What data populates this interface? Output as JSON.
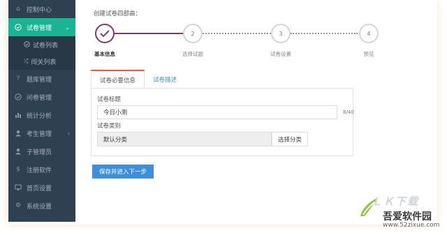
{
  "sidebar": {
    "items": [
      {
        "label": "控制中心",
        "icon": "home-icon"
      },
      {
        "label": "试卷管理",
        "icon": "check-circle-icon",
        "active": true
      },
      {
        "label": "题库管理",
        "icon": "question-icon"
      },
      {
        "label": "问卷管理",
        "icon": "check-circle-icon"
      },
      {
        "label": "统计分析",
        "icon": "bar-chart-icon"
      },
      {
        "label": "考生管理",
        "icon": "user-icon"
      },
      {
        "label": "子管理员",
        "icon": "user-icon"
      },
      {
        "label": "注册软件",
        "icon": "dollar-icon"
      },
      {
        "label": "首页设置",
        "icon": "monitor-icon"
      },
      {
        "label": "系统设置",
        "icon": "gear-icon"
      }
    ],
    "sub_items": [
      {
        "label": "试卷列表",
        "icon": "check-circle-icon"
      },
      {
        "label": "闯关列表",
        "icon": "shuffle-icon"
      }
    ]
  },
  "wizard": {
    "title": "创建试卷四部曲：",
    "steps": [
      {
        "number": "✓",
        "label": "基本信息"
      },
      {
        "number": "2",
        "label": "选择试题"
      },
      {
        "number": "3",
        "label": "试卷设置"
      },
      {
        "number": "4",
        "label": "预览"
      }
    ]
  },
  "tabs": [
    "试卷必要信息",
    "试卷描述"
  ],
  "form": {
    "title_label": "试卷标题",
    "title_value": "今日小测",
    "title_counter": "8/40",
    "category_label": "试卷类别",
    "category_value": "默认分类",
    "category_button": "选择分类"
  },
  "next_button": "保存并进入下一步",
  "watermark": {
    "text": "吾爱软件园",
    "url": "www.52zixue.com",
    "logo_text": "ＬＫ下载"
  },
  "colors": {
    "sidebar_bg": "#2f4050",
    "active": "#1ab394",
    "step_accent": "#7a3d73",
    "primary_button": "#3d8fdc",
    "tab_accent": "#e05a4f"
  }
}
